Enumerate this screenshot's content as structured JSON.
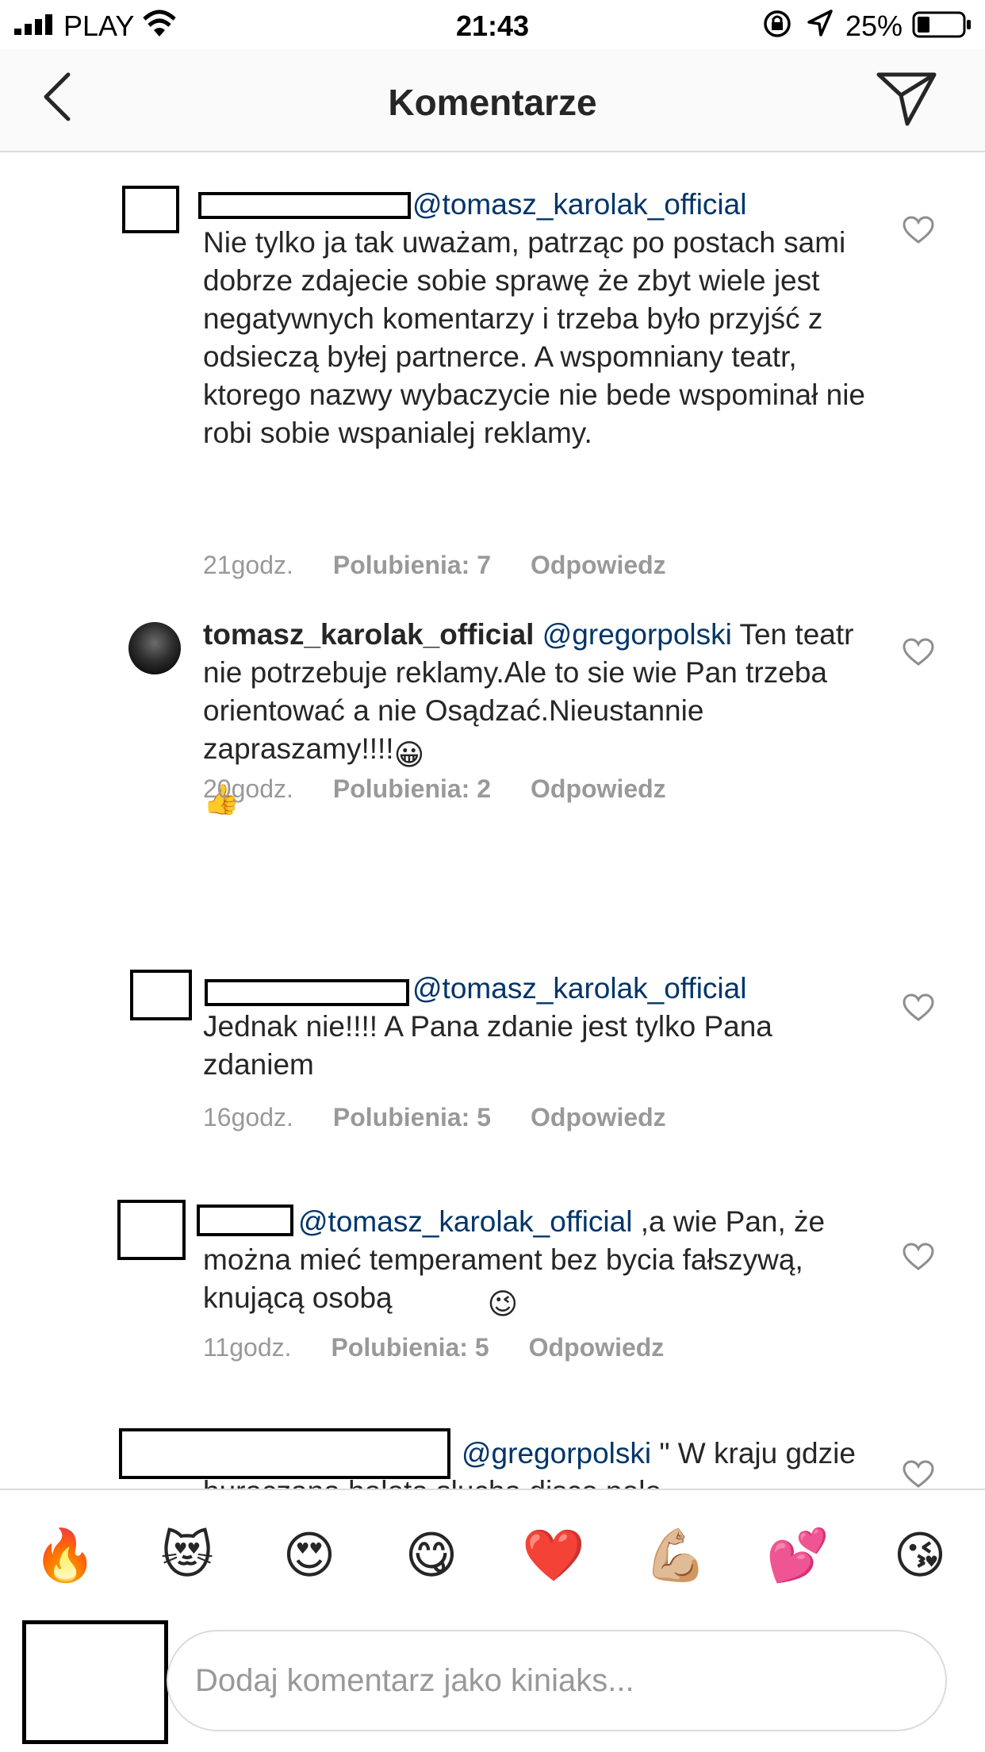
{
  "status_bar": {
    "carrier": "PLAY",
    "time": "21:43",
    "battery": "25%"
  },
  "header": {
    "title": "Komentarze"
  },
  "comments": [
    {
      "username": "",
      "mention": "@tomasz_karolak_official",
      "text": "Nie tylko ja tak uważam, patrząc po postach sami dobrze zdajecie sobie sprawę że zbyt wiele jest negatywnych komentarzy i trzeba było przyjść z odsieczą byłej partnerce. A wspomniany teatr, ktorego nazwy wybaczycie nie bede wspominał nie robi sobie wspanialej reklamy.",
      "time": "21godz.",
      "likes": "Polubienia: 7",
      "reply": "Odpowiedz"
    },
    {
      "username": "tomasz_karolak_official",
      "mention": "@gregorpolski",
      "text": "Ten teatr nie potrzebuje reklamy.Ale to sie wie Pan trzeba orientować a nie Osądzać.Nieustannie zapraszamy!!!!",
      "emoji1": "😀",
      "emoji2": "👍",
      "time": "20godz.",
      "likes": "Polubienia: 2",
      "reply": "Odpowiedz"
    },
    {
      "username": "",
      "mention": "@tomasz_karolak_official",
      "text": "Jednak nie!!!! A Pana zdanie jest tylko Pana zdaniem",
      "time": "16godz.",
      "likes": "Polubienia: 5",
      "reply": "Odpowiedz"
    },
    {
      "username": "",
      "mention": "@tomasz_karolak_official",
      "text": " ,a wie Pan, że można mieć temperament bez bycia fałszywą, knującą osobą",
      "emoji1": "😉",
      "time": "11godz.",
      "likes": "Polubienia: 5",
      "reply": "Odpowiedz"
    },
    {
      "username": "",
      "mention": "@gregorpolski",
      "text": " \" W kraju gdzie buraczana hołota słucha disco polo"
    }
  ],
  "emoji_bar": [
    "🔥",
    "😻",
    "😍",
    "😋",
    "❤️",
    "💪🏼",
    "💕",
    "😘"
  ],
  "input": {
    "placeholder": "Dodaj komentarz jako kiniaks..."
  },
  "icons": {
    "back": "chevron-left-icon",
    "share": "direct-share-icon",
    "like": "heart-outline-icon"
  }
}
